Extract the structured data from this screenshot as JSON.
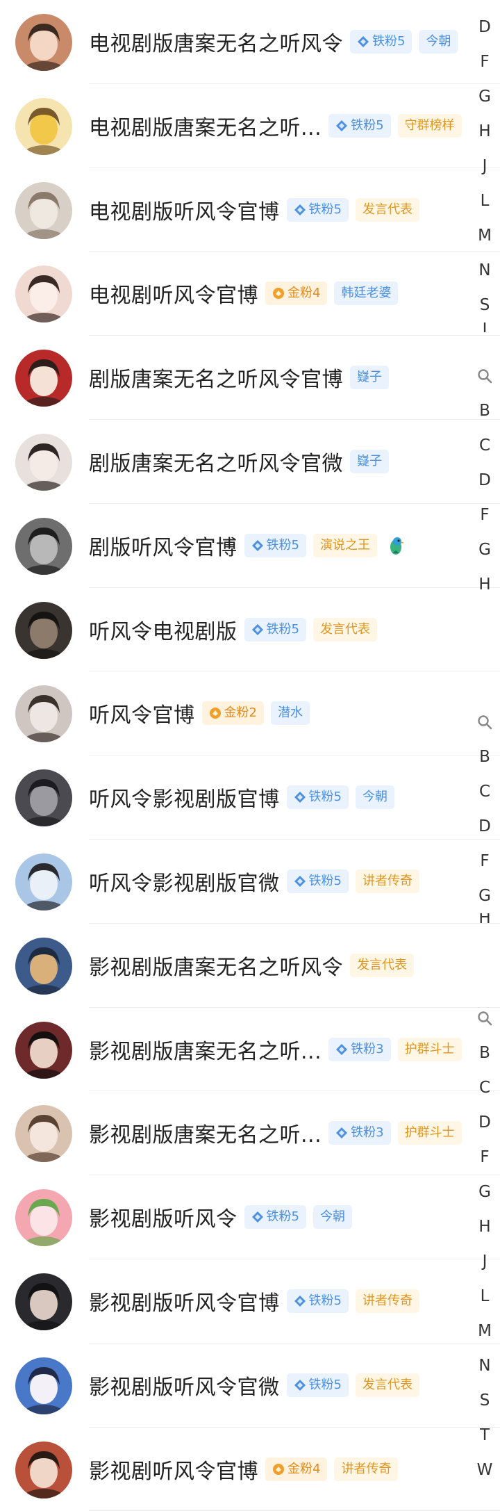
{
  "rows": [
    {
      "name": "电视剧版唐案无名之听风令",
      "level": "铁粉5",
      "level_type": "iron",
      "tag": "今朝",
      "tag_type": "blue",
      "avatar_colors": [
        "#c98a6a",
        "#f3d7c4",
        "#3b2a22"
      ]
    },
    {
      "name": "电视剧版唐案无名之听...",
      "level": "铁粉5",
      "level_type": "iron",
      "tag": "守群榜样",
      "tag_type": "orange",
      "avatar_colors": [
        "#f5e3b0",
        "#f2c84b",
        "#7a5a2a"
      ]
    },
    {
      "name": "电视剧版听风令官博",
      "level": "铁粉5",
      "level_type": "iron",
      "tag": "发言代表",
      "tag_type": "orange",
      "avatar_colors": [
        "#d8cfc6",
        "#efe8e0",
        "#8a7a6c"
      ]
    },
    {
      "name": "电视剧听风令官博",
      "level": "金粉4",
      "level_type": "gold",
      "tag": "韩廷老婆",
      "tag_type": "blue",
      "avatar_colors": [
        "#f0d9d0",
        "#fbeee8",
        "#3a2a26"
      ]
    },
    {
      "name": "剧版唐案无名之听风令官博",
      "level": "",
      "level_type": "",
      "tag": "嶷子",
      "tag_type": "blue",
      "avatar_colors": [
        "#b82a2a",
        "#f6e1d6",
        "#2c1e1a"
      ]
    },
    {
      "name": "剧版唐案无名之听风令官微",
      "level": "",
      "level_type": "",
      "tag": "嶷子",
      "tag_type": "blue",
      "avatar_colors": [
        "#e8e0dc",
        "#f5ebe6",
        "#2e2624"
      ]
    },
    {
      "name": "剧版听风令官博",
      "level": "铁粉5",
      "level_type": "iron",
      "tag": "演说之王",
      "tag_type": "orange",
      "avatar_colors": [
        "#6e6e6e",
        "#b8b8b8",
        "#1e1e1e"
      ],
      "extra_icon": "parrot-icon"
    },
    {
      "name": "听风令电视剧版",
      "level": "铁粉5",
      "level_type": "iron",
      "tag": "发言代表",
      "tag_type": "orange",
      "avatar_colors": [
        "#3a3430",
        "#8c7a6a",
        "#161412"
      ]
    },
    {
      "name": "听风令官博",
      "level": "金粉2",
      "level_type": "gold",
      "tag": "潜水",
      "tag_type": "blue",
      "avatar_colors": [
        "#cfc6c2",
        "#eee6e2",
        "#3a302c"
      ]
    },
    {
      "name": "听风令影视剧版官博",
      "level": "铁粉5",
      "level_type": "iron",
      "tag": "今朝",
      "tag_type": "blue",
      "avatar_colors": [
        "#4a4a50",
        "#9a9aa0",
        "#1c1c20"
      ]
    },
    {
      "name": "听风令影视剧版官微",
      "level": "铁粉5",
      "level_type": "iron",
      "tag": "讲者传奇",
      "tag_type": "orange",
      "avatar_colors": [
        "#a9c6e6",
        "#e9f0f8",
        "#2a2a2e"
      ]
    },
    {
      "name": "影视剧版唐案无名之听风令",
      "level": "",
      "level_type": "",
      "tag": "发言代表",
      "tag_type": "orange",
      "avatar_colors": [
        "#3c5a8a",
        "#d9b07a",
        "#1e2a40"
      ]
    },
    {
      "name": "影视剧版唐案无名之听...",
      "level": "铁粉3",
      "level_type": "iron",
      "tag": "护群斗士",
      "tag_type": "orange",
      "avatar_colors": [
        "#6e2a2a",
        "#e8cfc4",
        "#141010"
      ]
    },
    {
      "name": "影视剧版唐案无名之听...",
      "level": "铁粉3",
      "level_type": "iron",
      "tag": "护群斗士",
      "tag_type": "orange",
      "avatar_colors": [
        "#d9c2b0",
        "#f4e6dc",
        "#5a4234"
      ]
    },
    {
      "name": "影视剧版听风令",
      "level": "铁粉5",
      "level_type": "iron",
      "tag": "今朝",
      "tag_type": "blue",
      "avatar_colors": [
        "#f4a7b0",
        "#fbe3e6",
        "#6aa84f"
      ]
    },
    {
      "name": "影视剧版听风令官博",
      "level": "铁粉5",
      "level_type": "iron",
      "tag": "讲者传奇",
      "tag_type": "orange",
      "avatar_colors": [
        "#2a2a2e",
        "#d8c8c0",
        "#121214"
      ]
    },
    {
      "name": "影视剧版听风令官微",
      "level": "铁粉5",
      "level_type": "iron",
      "tag": "发言代表",
      "tag_type": "orange",
      "avatar_colors": [
        "#4a78c8",
        "#f3f0f7",
        "#202a48"
      ]
    },
    {
      "name": "影视剧听风令官博",
      "level": "金粉4",
      "level_type": "gold",
      "tag": "讲者传奇",
      "tag_type": "orange",
      "avatar_colors": [
        "#b8503a",
        "#f0d6c6",
        "#2a1a14"
      ]
    }
  ],
  "index_bars": [
    {
      "letters": [
        "D",
        "F",
        "G",
        "H",
        "J",
        "L",
        "M",
        "N",
        "S",
        "T"
      ],
      "cut_last": true,
      "has_search": false
    },
    {
      "letters": [
        "B",
        "C",
        "D",
        "F",
        "G",
        "H"
      ],
      "cut_last": false,
      "has_search": true
    },
    {
      "letters": [
        "B",
        "C",
        "D",
        "F",
        "G",
        "H"
      ],
      "cut_last": true,
      "has_search": true
    },
    {
      "letters": [
        "B",
        "C",
        "D",
        "F",
        "G",
        "H",
        "J",
        "L",
        "M",
        "N",
        "S",
        "T",
        "W"
      ],
      "cut_last": false,
      "has_search": true
    }
  ]
}
